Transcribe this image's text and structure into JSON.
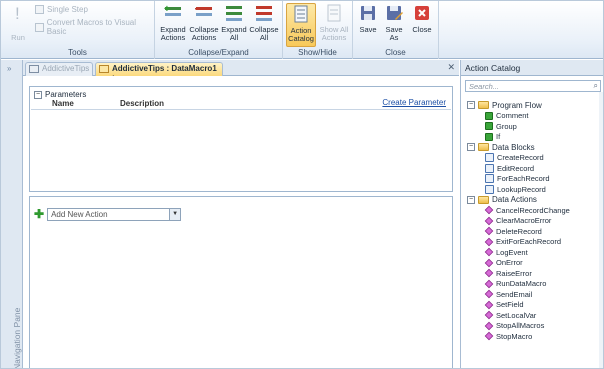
{
  "ribbon": {
    "tools": {
      "run_label": "Run",
      "single_step_label": "Single Step",
      "convert_label": "Convert Macros to Visual Basic",
      "group_label": "Tools"
    },
    "collapse_expand": {
      "expand_actions": [
        "Expand",
        "Actions"
      ],
      "collapse_actions": [
        "Collapse",
        "Actions"
      ],
      "expand_all": [
        "Expand",
        "All"
      ],
      "collapse_all": [
        "Collapse",
        "All"
      ],
      "group_label": "Collapse/Expand"
    },
    "show_hide": {
      "action_catalog": [
        "Action",
        "Catalog"
      ],
      "show_all_actions": [
        "Show All",
        "Actions"
      ],
      "group_label": "Show/Hide"
    },
    "close": {
      "save": "Save",
      "save_as": [
        "Save",
        "As"
      ],
      "close": "Close",
      "group_label": "Close"
    }
  },
  "nav_pane": {
    "label": "Navigation Pane"
  },
  "tabs": [
    {
      "label": "AddictiveTips",
      "active": false
    },
    {
      "label": "AddictiveTips : DataMacro1 :",
      "active": true
    }
  ],
  "designer": {
    "parameters": {
      "heading": "Parameters",
      "col_name": "Name",
      "col_description": "Description",
      "create_link": "Create Parameter"
    },
    "add_action_placeholder": "Add New Action"
  },
  "catalog": {
    "title": "Action Catalog",
    "search_placeholder": "Search...",
    "groups": [
      {
        "label": "Program Flow",
        "icon": "flow-icon",
        "items": [
          "Comment",
          "Group",
          "If"
        ]
      },
      {
        "label": "Data Blocks",
        "icon": "block-icon",
        "items": [
          "CreateRecord",
          "EditRecord",
          "ForEachRecord",
          "LookupRecord"
        ]
      },
      {
        "label": "Data Actions",
        "icon": "action-icon",
        "items": [
          "CancelRecordChange",
          "ClearMacroError",
          "DeleteRecord",
          "ExitForEachRecord",
          "LogEvent",
          "OnError",
          "RaiseError",
          "RunDataMacro",
          "SendEmail",
          "SetField",
          "SetLocalVar",
          "StopAllMacros",
          "StopMacro"
        ]
      }
    ]
  },
  "colors": {
    "ribbon_bg": "#eaf1f9",
    "active_tab": "#fbd97d",
    "accent_blue": "#1c4fa5"
  }
}
